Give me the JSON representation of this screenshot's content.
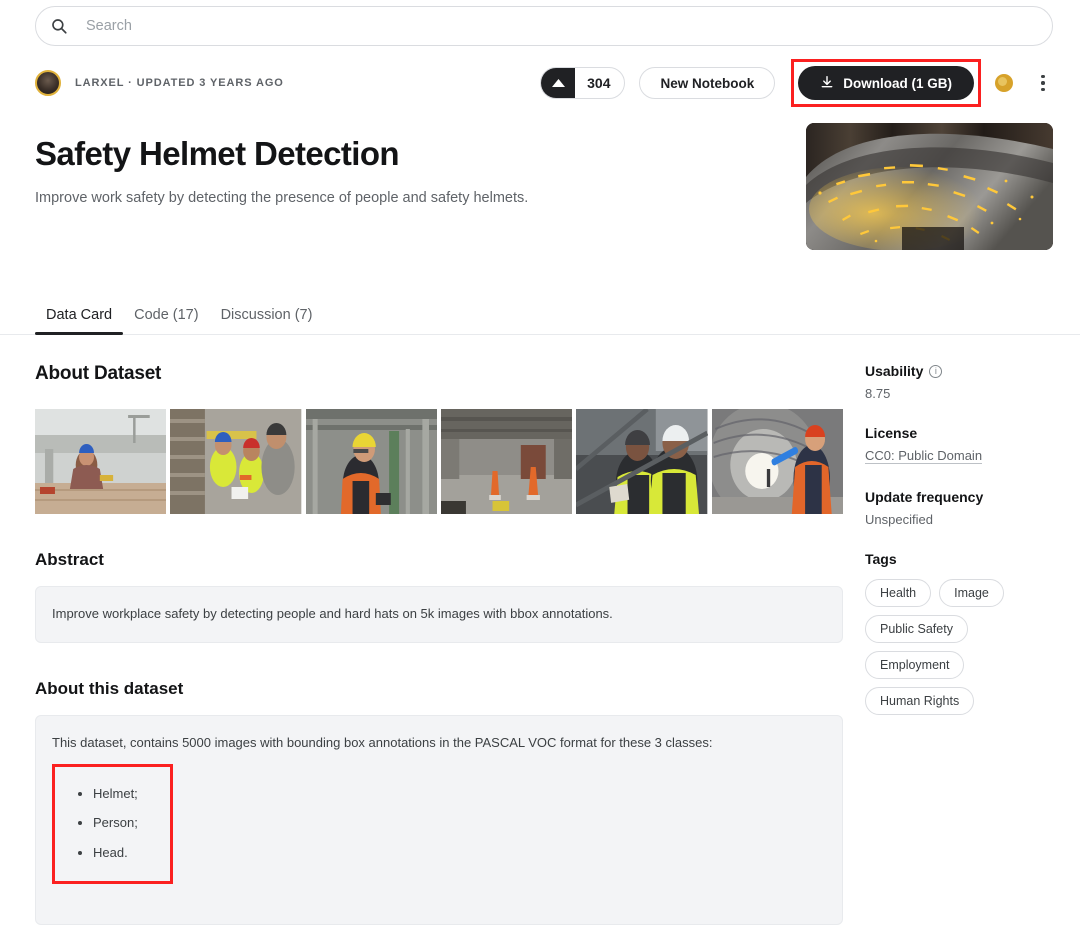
{
  "search": {
    "placeholder": "Search",
    "value": "",
    "icon": "search-icon"
  },
  "meta": {
    "owner_line": "LARXEL · UPDATED 3 YEARS AGO",
    "vote_count": "304",
    "new_notebook_label": "New Notebook",
    "download_label": "Download (1 GB)",
    "medal": "gold-medal-icon",
    "more_menu": "kebab-menu-icon"
  },
  "header": {
    "title": "Safety Helmet Detection",
    "subtitle": "Improve work safety by detecting the presence of people and safety helmets.",
    "hero_alt": "grinding-sparks-on-metal-pipe"
  },
  "tabs": [
    {
      "label": "Data Card",
      "active": true
    },
    {
      "label": "Code (17)",
      "active": false
    },
    {
      "label": "Discussion (7)",
      "active": false
    }
  ],
  "main": {
    "about_dataset_title": "About Dataset",
    "abstract_title": "Abstract",
    "abstract_text": "Improve workplace safety by detecting people and hard hats on 5k images with bbox annotations.",
    "about_this_dataset_title": "About this dataset",
    "about_this_dataset_text": "This dataset, contains 5000 images with bounding box annotations in the PASCAL VOC format for these 3 classes:",
    "classes": [
      "Helmet;",
      "Person;",
      "Head."
    ],
    "gallery": [
      "worker-blue-helmet-construction-site",
      "three-workers-reviewing-plans",
      "woman-yellow-helmet-industrial-plant",
      "industrial-corridor-safety-cones",
      "two-workers-white-helmets-stairs",
      "worker-orange-vest-tunnel"
    ]
  },
  "sidebar": {
    "usability_label": "Usability",
    "usability_value": "8.75",
    "license_label": "License",
    "license_value": "CC0: Public Domain",
    "update_frequency_label": "Update frequency",
    "update_frequency_value": "Unspecified",
    "tags_label": "Tags",
    "tags": [
      "Health",
      "Image",
      "Public Safety",
      "Employment",
      "Human Rights"
    ]
  },
  "colors": {
    "accent_dark": "#202124",
    "highlight_red": "#fb2020",
    "medal_gold": "#d7a22a",
    "panel_bg": "#f3f4f6"
  }
}
